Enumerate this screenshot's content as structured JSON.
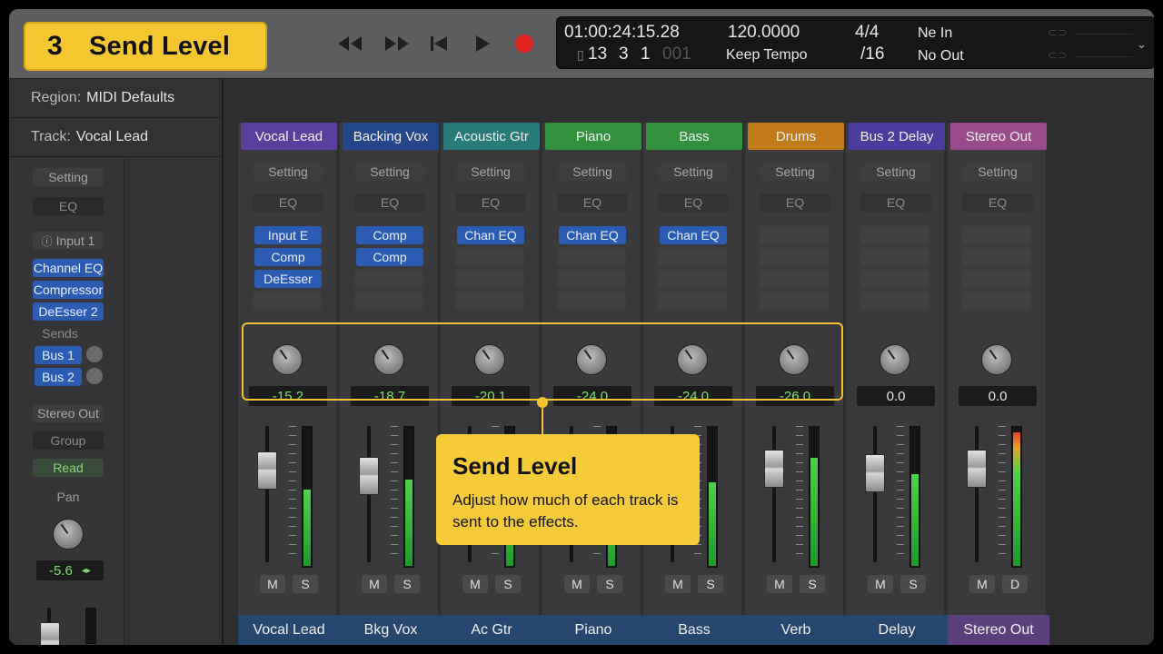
{
  "step": {
    "number": "3",
    "title": "Send Level"
  },
  "lcd": {
    "timecode": "01:00:24:15.28",
    "bars": "13",
    "beats": "3",
    "division": "1",
    "ticks": "001",
    "tempo": "120.0000",
    "tempo_mode": "Keep Tempo",
    "signature": "4/4",
    "subdivision": "/16",
    "midi_in": "Ne In",
    "midi_out": "No Out"
  },
  "inspector": {
    "region_label": "Region:",
    "region_value": "MIDI Defaults",
    "track_label": "Track:",
    "track_value": "Vocal Lead",
    "setting": "Setting",
    "eq": "EQ",
    "input": "Input 1",
    "plugins": [
      "Channel EQ",
      "Compressor",
      "DeEsser 2"
    ],
    "sends_label": "Sends",
    "sends": [
      "Bus 1",
      "Bus 2"
    ],
    "output": "Stereo Out",
    "group": "Group",
    "automation": "Read",
    "pan_label": "Pan",
    "pan_value": "-5.6"
  },
  "strip_labels": {
    "setting": "Setting",
    "eq": "EQ"
  },
  "channels": [
    {
      "name": "Vocal Lead",
      "bottom": "Vocal Lead",
      "color": "#5b3f9e",
      "bottom_color": "#24466f",
      "send": "-15.2",
      "send_active": true,
      "plugins": [
        "Input E",
        "Comp",
        "DeEsser"
      ],
      "m": "M",
      "s": "S",
      "meter": 0.55,
      "fader": 0.78
    },
    {
      "name": "Backing Vox",
      "bottom": "Bkg Vox",
      "color": "#24478c",
      "bottom_color": "#24466f",
      "send": "-18.7",
      "send_active": true,
      "plugins": [
        "Comp",
        "Comp"
      ],
      "m": "M",
      "s": "S",
      "meter": 0.62,
      "fader": 0.72
    },
    {
      "name": "Acoustic Gtr",
      "bottom": "Ac Gtr",
      "color": "#277a78",
      "bottom_color": "#24466f",
      "send": "-20.1",
      "send_active": true,
      "plugins": [
        "Chan EQ"
      ],
      "m": "M",
      "s": "S",
      "meter": 0.5,
      "fader": 0.7
    },
    {
      "name": "Piano",
      "bottom": "Piano",
      "color": "#33903d",
      "bottom_color": "#24466f",
      "send": "-24.0",
      "send_active": true,
      "plugins": [
        "Chan EQ"
      ],
      "m": "M",
      "s": "S",
      "meter": 0.45,
      "fader": 0.68
    },
    {
      "name": "Bass",
      "bottom": "Bass",
      "color": "#33903d",
      "bottom_color": "#24466f",
      "send": "-24.0",
      "send_active": true,
      "plugins": [
        "Chan EQ"
      ],
      "m": "M",
      "s": "S",
      "meter": 0.6,
      "fader": 0.7
    },
    {
      "name": "Drums",
      "bottom": "Verb",
      "color": "#c27a1b",
      "bottom_color": "#24466f",
      "send": "-26.0",
      "send_active": true,
      "plugins": [],
      "m": "M",
      "s": "S",
      "meter": 0.78,
      "fader": 0.8
    },
    {
      "name": "Bus 2 Delay",
      "bottom": "Delay",
      "color": "#4a3b9c",
      "bottom_color": "#24466f",
      "send": "0.0",
      "send_active": false,
      "plugins": [],
      "m": "M",
      "s": "S",
      "meter": 0.66,
      "fader": 0.75
    },
    {
      "name": "Stereo Out",
      "bottom": "Stereo Out",
      "color": "#9a4a8a",
      "bottom_color": "#5b3f7e",
      "send": "0.0",
      "send_active": false,
      "plugins": [],
      "m": "M",
      "s": "D",
      "meter": 0.96,
      "fader": 0.8
    }
  ],
  "callout": {
    "title": "Send Level",
    "description": "Adjust how much of each track is sent to the effects."
  },
  "colors": {
    "accent": "#f4c731",
    "record": "#e0241f",
    "active_value": "#7fe06e",
    "inactive_value": "#e6e6e6"
  }
}
